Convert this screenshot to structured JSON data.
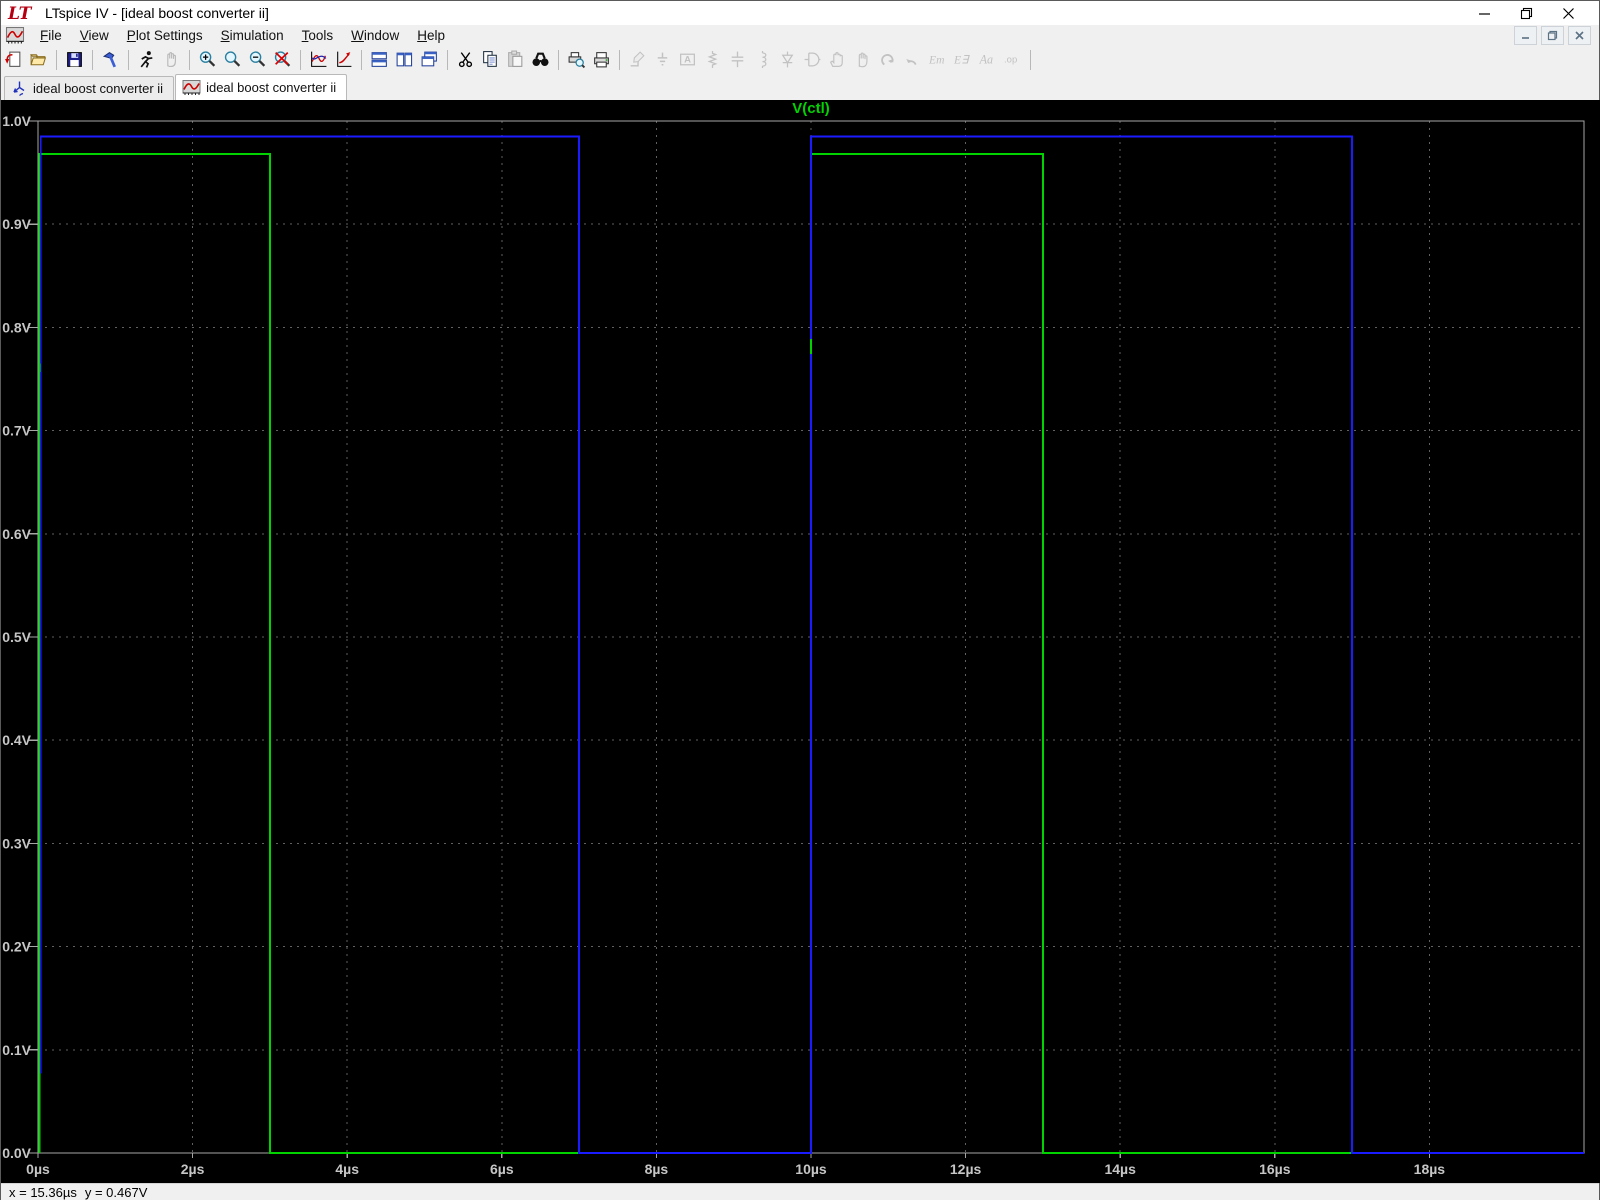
{
  "window": {
    "title": "LTspice IV - [ideal boost converter ii]",
    "app_logo": "LT",
    "controls": [
      {
        "name": "minimize-button",
        "glyph": "minimize"
      },
      {
        "name": "restore-button",
        "glyph": "restore"
      },
      {
        "name": "close-button",
        "glyph": "close"
      }
    ]
  },
  "menu": {
    "items": [
      {
        "label": "File",
        "key": "F"
      },
      {
        "label": "View",
        "key": "V"
      },
      {
        "label": "Plot Settings",
        "key": "P"
      },
      {
        "label": "Simulation",
        "key": "S"
      },
      {
        "label": "Tools",
        "key": "T"
      },
      {
        "label": "Window",
        "key": "W"
      },
      {
        "label": "Help",
        "key": "H"
      }
    ],
    "mdi_controls": [
      {
        "name": "mdi-minimize-button",
        "glyph": "minimize"
      },
      {
        "name": "mdi-restore-button",
        "glyph": "restore"
      },
      {
        "name": "mdi-close-button",
        "glyph": "close"
      }
    ]
  },
  "toolbar": {
    "items": [
      {
        "name": "new-schematic-button",
        "icon": "doc-new-icon"
      },
      {
        "name": "open-button",
        "icon": "folder-open-icon"
      },
      {
        "sep": true
      },
      {
        "name": "save-button",
        "icon": "floppy-icon"
      },
      {
        "sep": true
      },
      {
        "name": "control-panel-button",
        "icon": "hammer-icon"
      },
      {
        "sep": true
      },
      {
        "name": "run-button",
        "icon": "run-man-icon"
      },
      {
        "name": "halt-button",
        "icon": "halt-hand-icon",
        "disabled": true
      },
      {
        "sep": true
      },
      {
        "name": "zoom-area-button",
        "icon": "zoom-in-icon"
      },
      {
        "name": "zoom-back-button",
        "icon": "zoom-back-icon"
      },
      {
        "name": "zoom-out-button",
        "icon": "zoom-out-icon"
      },
      {
        "name": "zoom-full-extents-button",
        "icon": "zoom-extents-icon"
      },
      {
        "sep": true
      },
      {
        "name": "autorange-y-button",
        "icon": "autorange-plot-icon"
      },
      {
        "name": "plot-pane-button",
        "icon": "pan-plot-icon"
      },
      {
        "sep": true
      },
      {
        "name": "tile-horizontal-button",
        "icon": "tile-horizontal-icon"
      },
      {
        "name": "tile-vertical-button",
        "icon": "tile-vertical-icon"
      },
      {
        "name": "cascade-windows-button",
        "icon": "cascade-icon"
      },
      {
        "sep": true
      },
      {
        "name": "cut-button",
        "icon": "scissors-icon"
      },
      {
        "name": "copy-button",
        "icon": "copy-icon"
      },
      {
        "name": "paste-button",
        "icon": "paste-icon",
        "disabled": true
      },
      {
        "name": "find-button",
        "icon": "binoculars-icon"
      },
      {
        "sep": true
      },
      {
        "name": "print-preview-button",
        "icon": "print-preview-icon"
      },
      {
        "name": "print-button",
        "icon": "printer-icon"
      },
      {
        "sep": true
      },
      {
        "name": "draw-wire-button",
        "icon": "wire-pencil-icon",
        "disabled": true
      },
      {
        "name": "ground-button",
        "icon": "ground-icon",
        "disabled": true
      },
      {
        "name": "net-label-button",
        "icon": "net-label-icon",
        "disabled": true
      },
      {
        "name": "resistor-button",
        "icon": "resistor-icon",
        "disabled": true
      },
      {
        "name": "capacitor-button",
        "icon": "capacitor-icon",
        "disabled": true
      },
      {
        "name": "inductor-button",
        "icon": "inductor-icon",
        "disabled": true
      },
      {
        "name": "diode-button",
        "icon": "diode-icon",
        "disabled": true
      },
      {
        "name": "component-button",
        "icon": "component-icon",
        "disabled": true
      },
      {
        "name": "move-button",
        "icon": "move-hand-icon",
        "disabled": true
      },
      {
        "name": "drag-button",
        "icon": "drag-hand-icon",
        "disabled": true
      },
      {
        "name": "undo-button",
        "icon": "undo-icon",
        "disabled": true
      },
      {
        "name": "redo-button",
        "icon": "redo-icon",
        "disabled": true
      },
      {
        "name": "mirror-button",
        "icon": "mirror-icon",
        "disabled": true
      },
      {
        "name": "rotate-button",
        "icon": "rotate-icon",
        "disabled": true
      },
      {
        "name": "text-button",
        "icon": "text-icon",
        "disabled": true
      },
      {
        "name": "spice-directive-button",
        "icon": "spice-directive-icon",
        "disabled": true
      },
      {
        "sep": true
      }
    ]
  },
  "tabs": [
    {
      "label": "ideal boost converter ii",
      "icon": "schematic-tab-icon",
      "active": false
    },
    {
      "label": "ideal boost converter ii",
      "icon": "waveform-tab-icon",
      "active": true
    }
  ],
  "chart_data": {
    "type": "line",
    "title": "V(ctl)",
    "title_color": "#00d300",
    "xlabel": "",
    "ylabel": "",
    "xlim_us": [
      0,
      20
    ],
    "ylim_v": [
      0,
      1.0
    ],
    "grid": true,
    "background": "#000000",
    "x_ticks": [
      {
        "t": 0,
        "label": "0µs"
      },
      {
        "t": 2,
        "label": "2µs"
      },
      {
        "t": 4,
        "label": "4µs"
      },
      {
        "t": 6,
        "label": "6µs"
      },
      {
        "t": 8,
        "label": "8µs"
      },
      {
        "t": 10,
        "label": "10µs"
      },
      {
        "t": 12,
        "label": "12µs"
      },
      {
        "t": 14,
        "label": "14µs"
      },
      {
        "t": 16,
        "label": "16µs"
      },
      {
        "t": 18,
        "label": "18µs"
      }
    ],
    "y_ticks": [
      {
        "v": 0.0,
        "label": "0.0V"
      },
      {
        "v": 0.1,
        "label": "0.1V"
      },
      {
        "v": 0.2,
        "label": "0.2V"
      },
      {
        "v": 0.3,
        "label": "0.3V"
      },
      {
        "v": 0.4,
        "label": "0.4V"
      },
      {
        "v": 0.5,
        "label": "0.5V"
      },
      {
        "v": 0.6,
        "label": "0.6V"
      },
      {
        "v": 0.7,
        "label": "0.7V"
      },
      {
        "v": 0.8,
        "label": "0.8V"
      },
      {
        "v": 0.9,
        "label": "0.9V"
      },
      {
        "v": 1.0,
        "label": "1.0V"
      }
    ],
    "series": [
      {
        "name": "V(ctl) green trace",
        "color": "#00d300",
        "points_us_v": [
          [
            0.02,
            0
          ],
          [
            0.02,
            0.968
          ],
          [
            3,
            0.968
          ],
          [
            3,
            0
          ],
          [
            10,
            0
          ],
          [
            10,
            0.968
          ],
          [
            13,
            0.968
          ],
          [
            13,
            0
          ],
          [
            20,
            0
          ]
        ]
      },
      {
        "name": "V(ctl) blue trace",
        "color": "#1b1bff",
        "points_us_v": [
          [
            0.035,
            0.077
          ],
          [
            0.035,
            0.985
          ],
          [
            7,
            0.985
          ],
          [
            7,
            0
          ],
          [
            10,
            0
          ],
          [
            10,
            0.985
          ],
          [
            17,
            0.985
          ],
          [
            17,
            0
          ],
          [
            20,
            0
          ]
        ]
      }
    ],
    "green_visible_gap_segments": [
      {
        "t": 0.02,
        "v_from": 0.757,
        "v_to": 0.765
      },
      {
        "t": 10,
        "v_from": 0.774,
        "v_to": 0.789
      }
    ]
  },
  "status_bar": {
    "x_readout": "x = 15.36µs",
    "y_readout": "y = 0.467V"
  },
  "colors": {
    "grid": "#616161",
    "border": "#a6a6a6",
    "tick_label": "#c6c6c6",
    "plot_bg": "#000000",
    "chrome_bg": "#f0f0f0"
  }
}
